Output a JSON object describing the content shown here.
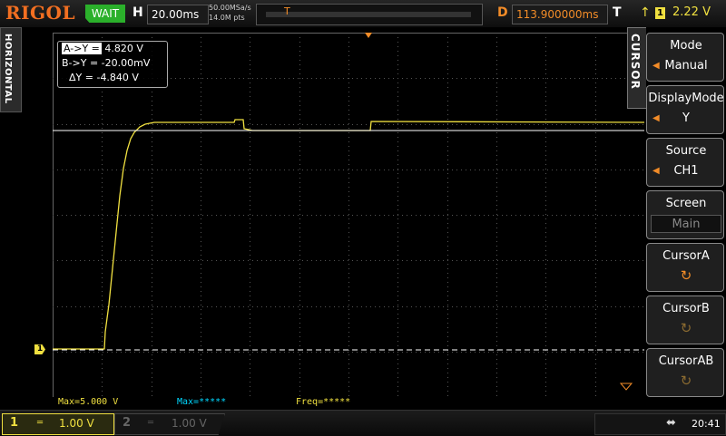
{
  "topbar": {
    "brand": "RIGOL",
    "run_state": "WAIT",
    "h_label": "H",
    "timebase": "20.00ms",
    "sample_rate": "50.00MSa/s",
    "memory_depth": "14.0M pts",
    "d_label": "D",
    "delay": "113.900000ms",
    "t_label": "T",
    "trigger_channel": "1",
    "trigger_level": "2.22 V"
  },
  "left_tab": {
    "label": "HORIZONTAL"
  },
  "cursor_readout": {
    "a_key": "A->Y =",
    "a_value": "4.820 V",
    "b_key": "B->Y =",
    "b_value": "-20.00mV",
    "delta_key": "ΔY =",
    "delta_value": "-4.840 V"
  },
  "channel_marker": "1",
  "measurements": {
    "max_ch1": "Max=5.000 V",
    "max_ch2": "Max=*****",
    "freq": "Freq=*****"
  },
  "menu": {
    "tab_label": "CURSOR",
    "items": [
      {
        "title": "Mode",
        "value": "Manual"
      },
      {
        "title": "DisplayMode",
        "value": "Y"
      },
      {
        "title": "Source",
        "value": "CH1"
      },
      {
        "title": "Screen",
        "value": "Main"
      },
      {
        "title": "CursorA"
      },
      {
        "title": "CursorB"
      },
      {
        "title": "CursorAB"
      }
    ]
  },
  "bottombar": {
    "ch1_number": "1",
    "ch1_scale": "1.00 V",
    "ch2_number": "2",
    "ch2_scale": "1.00 V",
    "clock": "20:41"
  },
  "colors": {
    "ch1": "#f0e040",
    "accent": "#f28c28",
    "run_green": "#2bb02b",
    "brand": "#f26f21"
  },
  "icons": {
    "trigger": "rising-edge-icon",
    "usb": "usb-icon",
    "knob": "rotate-knob-icon"
  }
}
